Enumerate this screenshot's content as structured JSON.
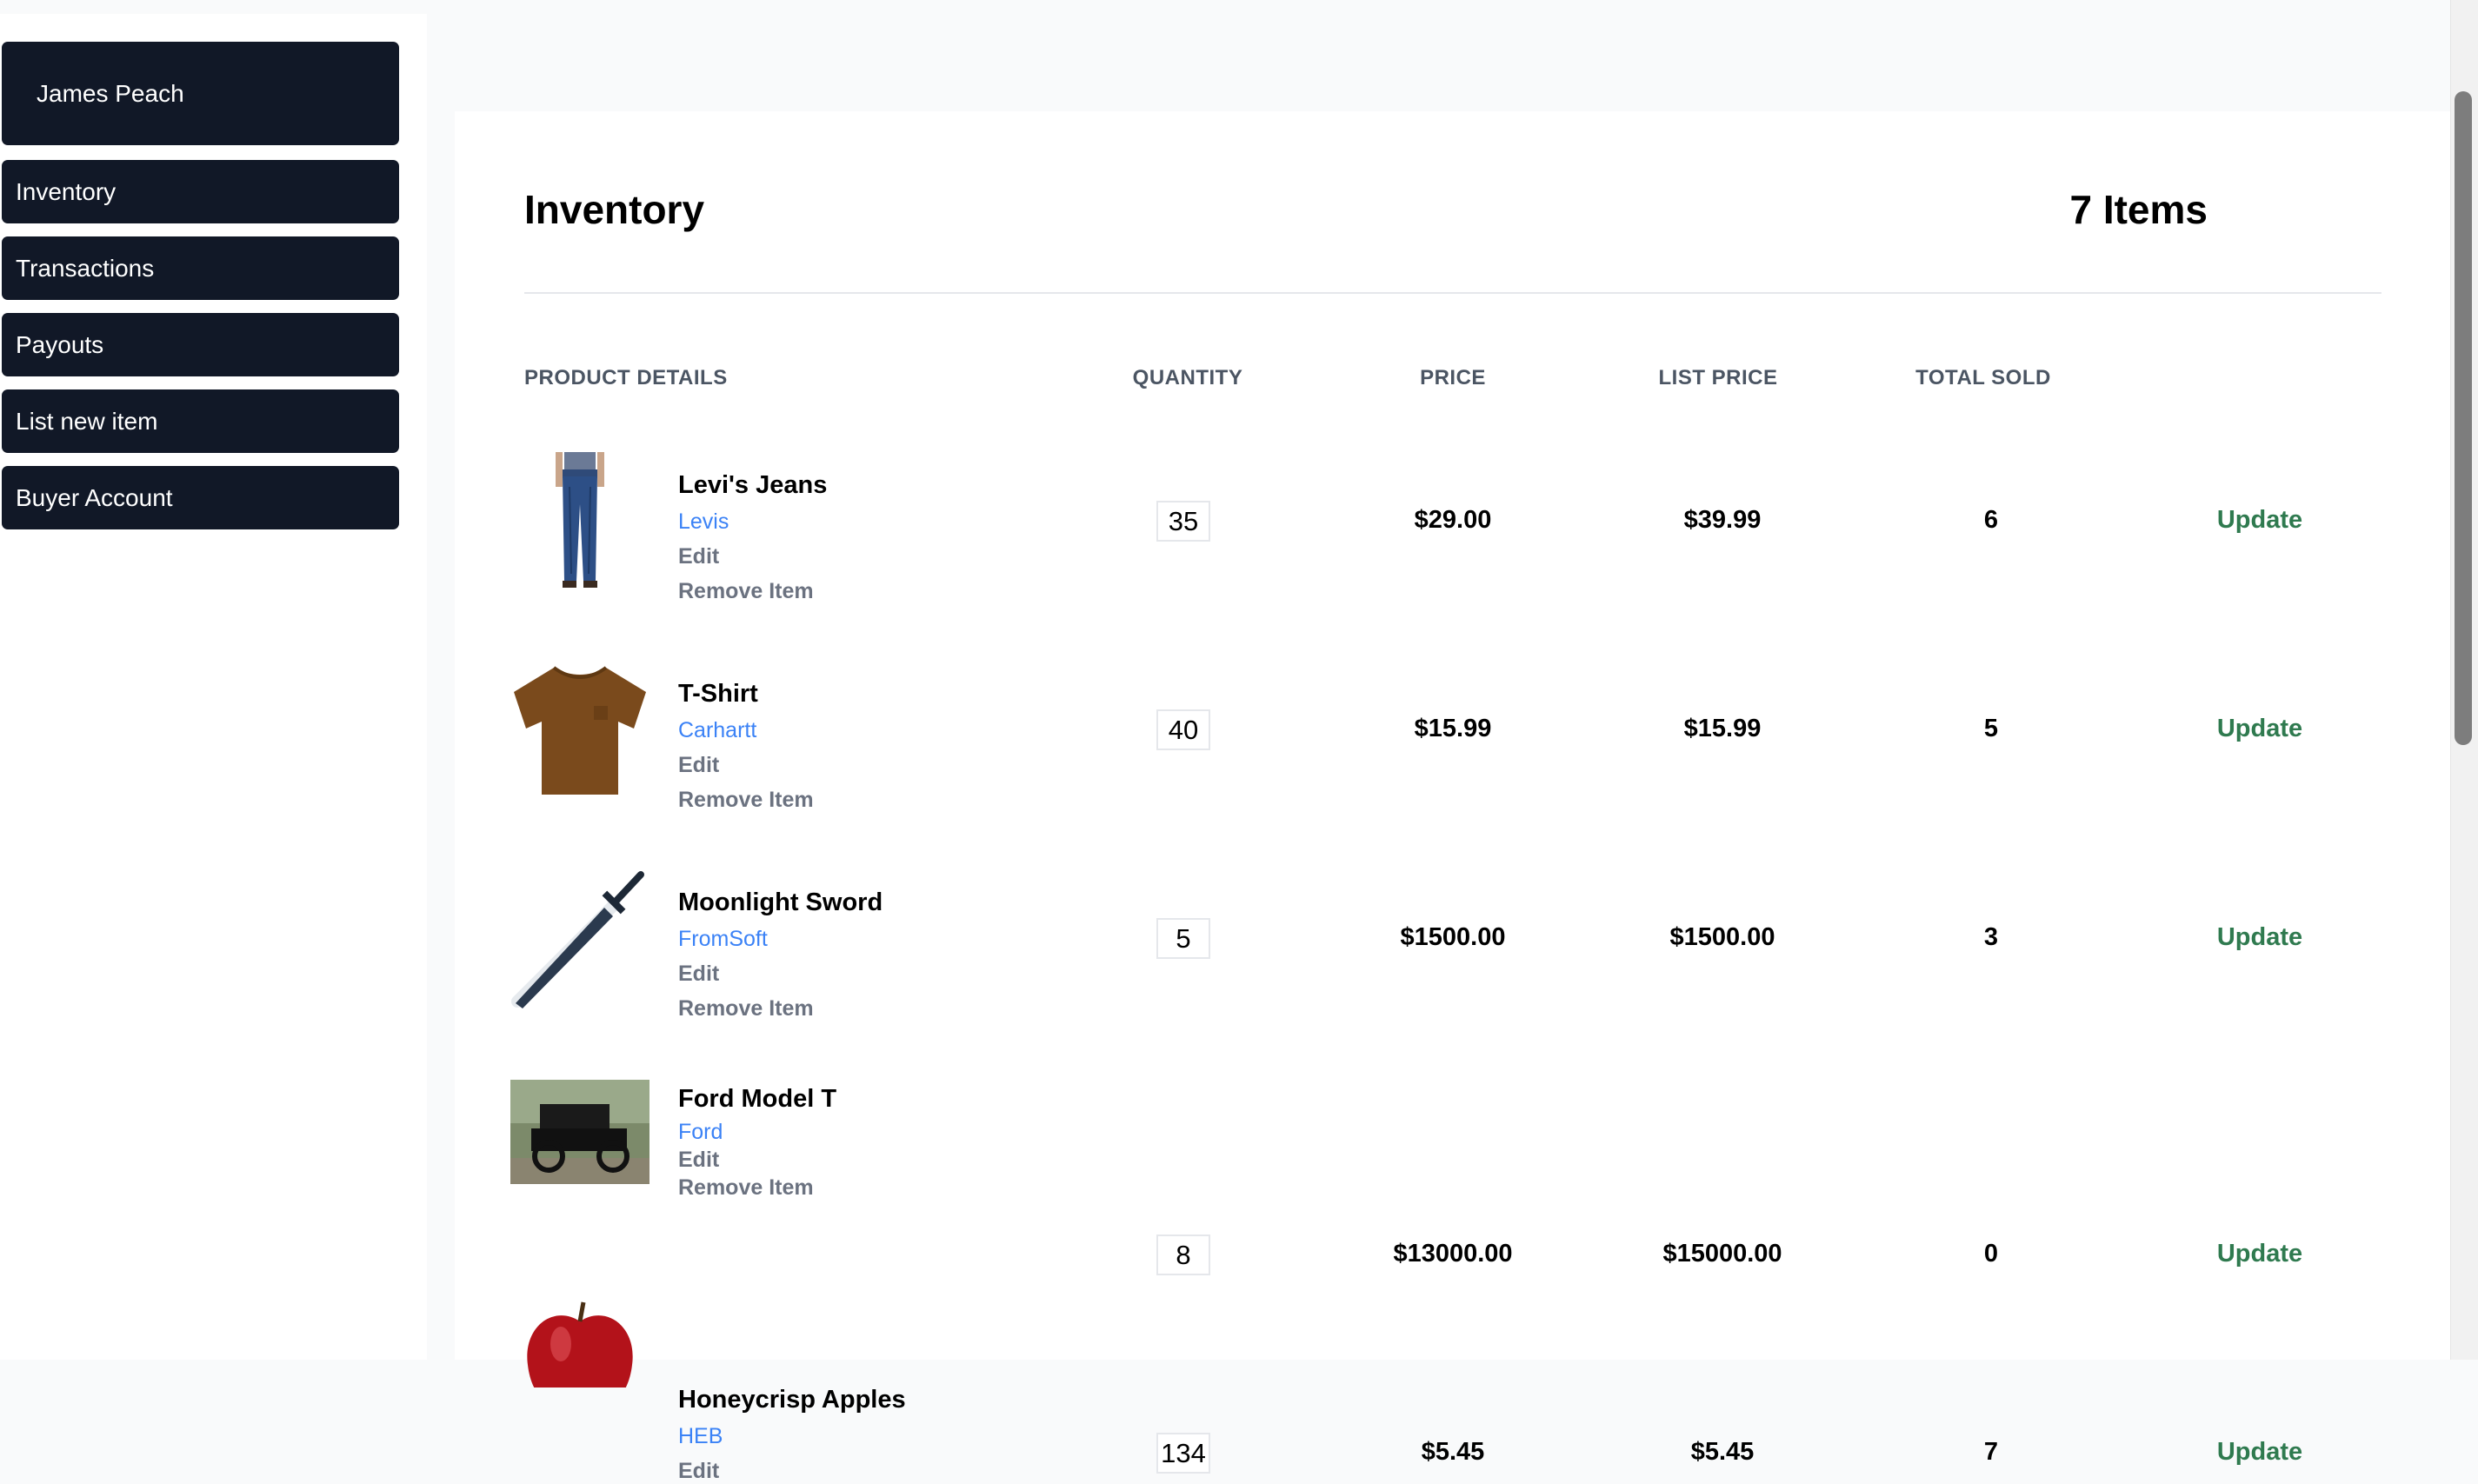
{
  "sidebar": {
    "user_name": "James Peach",
    "items": [
      {
        "label": "Inventory"
      },
      {
        "label": "Transactions"
      },
      {
        "label": "Payouts"
      },
      {
        "label": "List new item"
      },
      {
        "label": "Buyer Account"
      }
    ]
  },
  "main": {
    "title": "Inventory",
    "item_count": "7 Items",
    "columns": {
      "product_details": "PRODUCT DETAILS",
      "quantity": "QUANTITY",
      "price": "PRICE",
      "list_price": "LIST PRICE",
      "total_sold": "TOTAL SOLD"
    },
    "edit_label": "Edit",
    "remove_label": "Remove Item",
    "update_label": "Update",
    "products": [
      {
        "name": "Levi's Jeans",
        "brand": "Levis",
        "quantity": "35",
        "price": "$29.00",
        "list_price": "$39.99",
        "total_sold": "6",
        "image": "jeans"
      },
      {
        "name": "T-Shirt",
        "brand": "Carhartt",
        "quantity": "40",
        "price": "$15.99",
        "list_price": "$15.99",
        "total_sold": "5",
        "image": "t-shirt"
      },
      {
        "name": "Moonlight Sword",
        "brand": "FromSoft",
        "quantity": "5",
        "price": "$1500.00",
        "list_price": "$1500.00",
        "total_sold": "3",
        "image": "sword"
      },
      {
        "name": "Ford Model T",
        "brand": "Ford",
        "quantity": "8",
        "price": "$13000.00",
        "list_price": "$15000.00",
        "total_sold": "0",
        "image": "car"
      },
      {
        "name": "Honeycrisp Apples",
        "brand": "HEB",
        "quantity": "134",
        "price": "$5.45",
        "list_price": "$5.45",
        "total_sold": "7",
        "image": "apple"
      }
    ]
  },
  "colors": {
    "nav_bg": "#111827",
    "brand_link": "#3b82f6",
    "update_link": "#2f7a4f",
    "muted_text": "#6b7280"
  }
}
